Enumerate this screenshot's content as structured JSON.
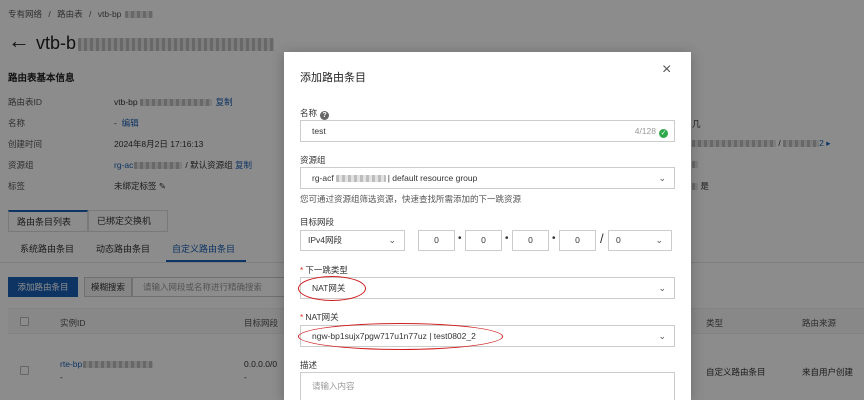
{
  "breadcrumb": [
    "专有网络",
    "/",
    "路由表",
    "/",
    "vtb-bp"
  ],
  "page_title": "vtb-b",
  "basic_info": {
    "title": "路由表基本信息",
    "rows": [
      {
        "key": "路由表ID",
        "value": "vtb-bp",
        "action": "复制"
      },
      {
        "key": "名称",
        "value": "-",
        "action": "编辑"
      },
      {
        "key": "创建时间",
        "value": "2024年8月2日 17:16:13"
      },
      {
        "key": "资源组",
        "value": "rg-ac",
        "value2": "/ 默认资源组",
        "action": "复制"
      },
      {
        "key": "标签",
        "value": "未绑定标签"
      }
    ],
    "right_fragments": [
      "/",
      "/",
      "2 ▸",
      "是"
    ]
  },
  "tabs": [
    "路由条目列表",
    "已绑定交换机"
  ],
  "sub_tabs": [
    "系统路由条目",
    "动态路由条目",
    "自定义路由条目"
  ],
  "toolbar": {
    "add": "添加路由条目",
    "fuzzy": "模糊搜索",
    "search_placeholder": "请输入网段或名称进行精确搜索"
  },
  "table": {
    "headers": [
      "实例ID",
      "目标网段",
      "类型",
      "路由来源"
    ],
    "row": {
      "id": "rte-bp",
      "id_sub": "-",
      "cidr": "0.0.0.0/0",
      "cidr_sub": "-",
      "type": "自定义路由条目",
      "source": "来自用户创建"
    }
  },
  "modal": {
    "title": "添加路由条目",
    "close": "×",
    "name_label": "名称",
    "name_value": "test",
    "name_counter": "4/128",
    "rg_label": "资源组",
    "rg_value_prefix": "rg-acf",
    "rg_value_suffix": "| default resource group",
    "rg_hint": "您可通过资源组筛选资源，快速查找所需添加的下一跳资源",
    "cidr_label": "目标网段",
    "cidr_type": "IPv4网段",
    "ip": [
      "0",
      "0",
      "0",
      "0"
    ],
    "mask": "0",
    "nexthop_label": "下一跳类型",
    "nexthop_value": "NAT网关",
    "nat_label": "NAT网关",
    "nat_value": "ngw-bp1sujx7pgw717u1n77uz | test0802_2",
    "desc_label": "描述",
    "desc_placeholder": "请输入内容"
  },
  "colors": {
    "accent": "#1a5fb4",
    "annotation": "#d01c1c",
    "success": "#2ea84a"
  }
}
